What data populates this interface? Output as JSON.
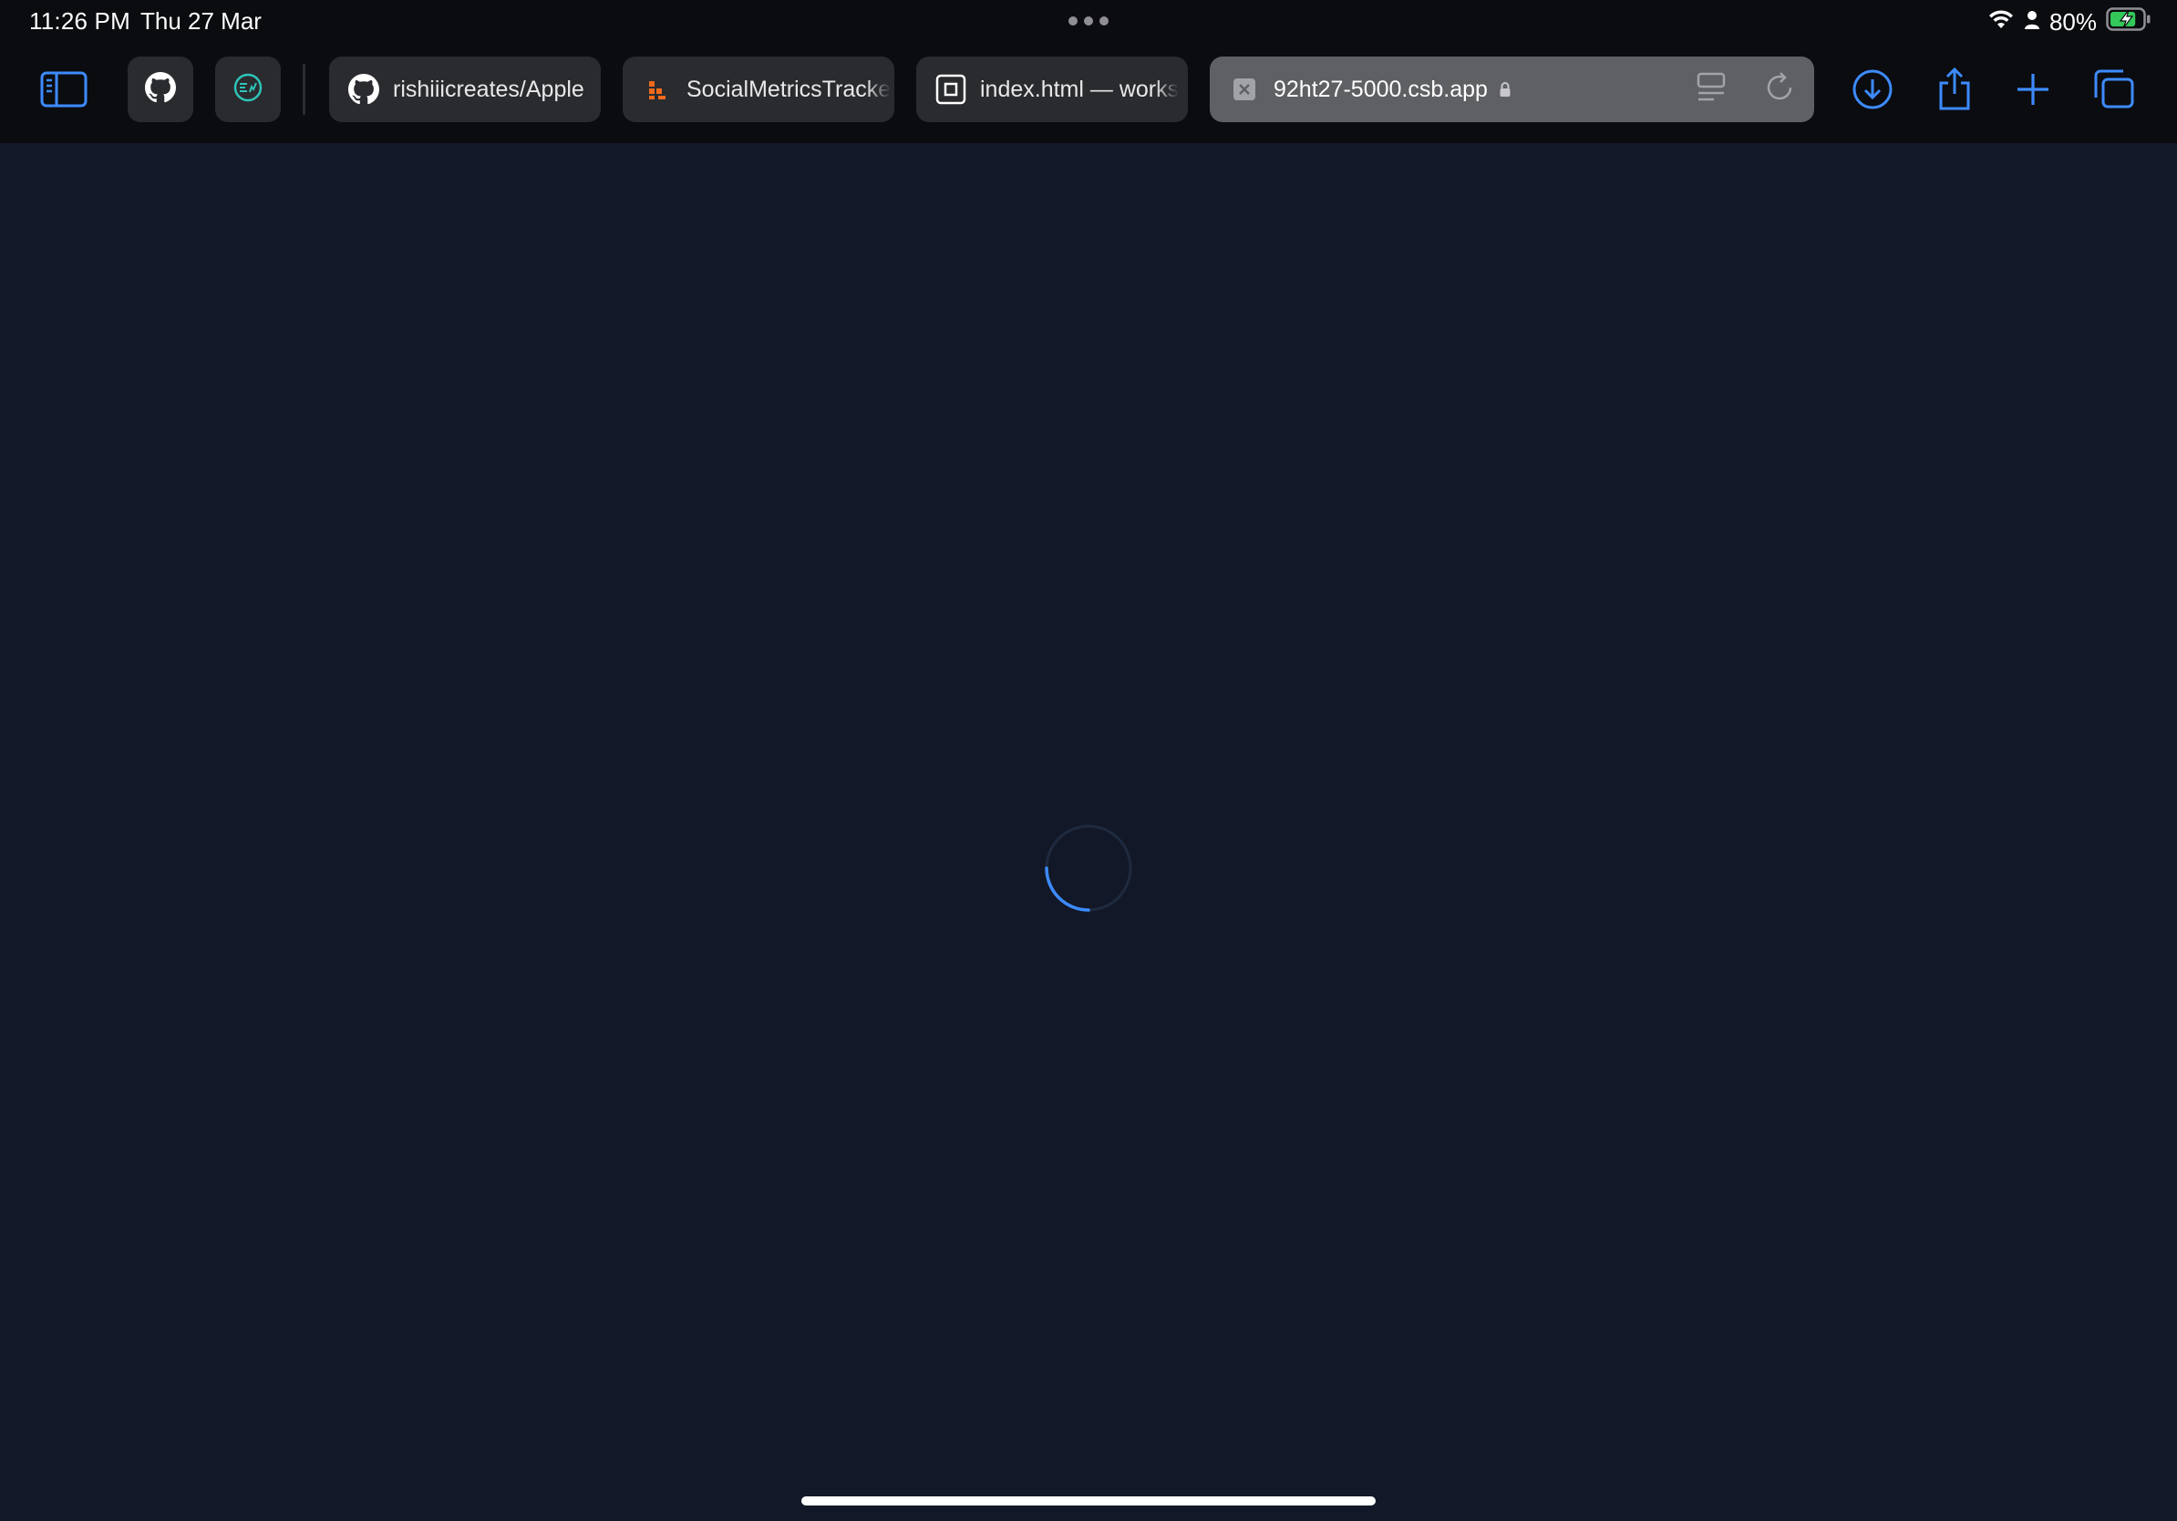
{
  "status_bar": {
    "time": "11:26 PM",
    "date": "Thu 27 Mar",
    "battery_percent": "80%",
    "battery_level": 0.8,
    "battery_charging": true
  },
  "toolbar": {
    "sidebar_icon": "sidebar-icon",
    "pinned_tabs": [
      {
        "icon": "github-icon"
      },
      {
        "icon": "globe-chart-icon"
      }
    ],
    "tabs": [
      {
        "icon": "github-icon",
        "label": "rishiiicreates/Apple"
      },
      {
        "icon": "dots-logo-icon",
        "label": "SocialMetricsTracke"
      },
      {
        "icon": "square-frame-icon",
        "label": "index.html — works"
      }
    ],
    "active_tab": {
      "url": "92ht27-5000.csb.app",
      "secure": true
    },
    "actions": [
      "download-icon",
      "share-icon",
      "plus-icon",
      "tabs-overview-icon"
    ]
  },
  "colors": {
    "accent": "#3d8bff",
    "page_background": "#121827",
    "toolbar_background": "#0b0c10",
    "tab_background": "#2a2b2f",
    "active_tab_background": "#5f6064",
    "battery_green": "#34c759"
  },
  "page": {
    "state": "loading"
  }
}
